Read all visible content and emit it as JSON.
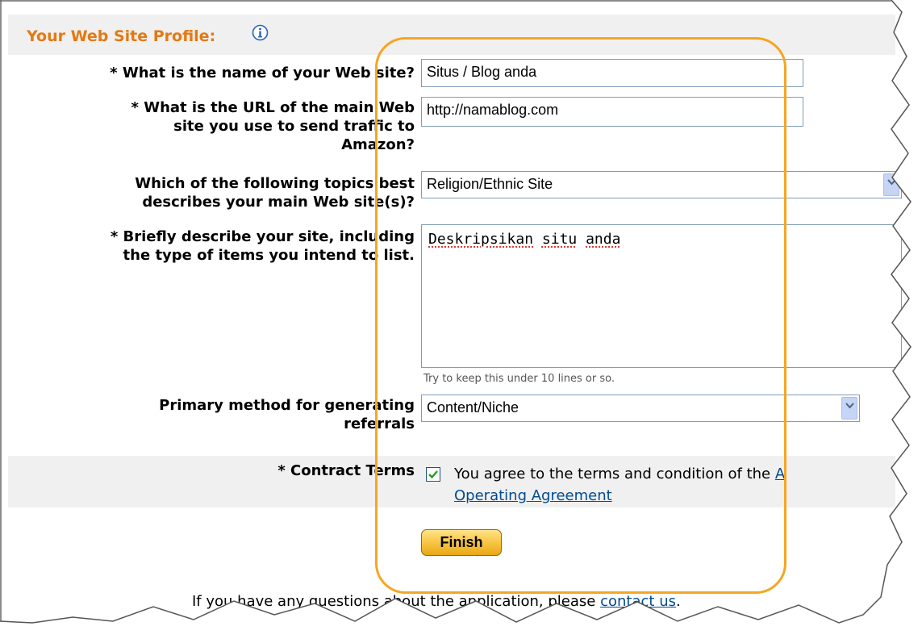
{
  "section": {
    "title": "Your Web Site Profile:"
  },
  "icons": {
    "info": "info-circle-icon",
    "dropdown": "chevron-down-icon",
    "check": "checkmark-icon"
  },
  "colors": {
    "title": "#e47911",
    "link": "#004b91",
    "highlight": "#f5a623",
    "band": "#f0f0f0",
    "button": "#f7c23d"
  },
  "fields": {
    "site_name": {
      "label": "* What is the name of your Web site?",
      "value": "Situs / Blog anda"
    },
    "site_url": {
      "label_lines": [
        "* What is the URL of the main Web",
        "site you use to send traffic to",
        "Amazon?"
      ],
      "value": "http://namablog.com"
    },
    "topic": {
      "label_lines": [
        "Which of the following topics best",
        "describes your main Web site(s)?"
      ],
      "value": "Religion/Ethnic Site"
    },
    "description": {
      "label_lines": [
        "* Briefly describe your site, including",
        "the type of items you intend to list."
      ],
      "words": [
        "Deskripsikan",
        "situ",
        "anda"
      ],
      "hint": "Try to keep this under 10 lines or so."
    },
    "referrals": {
      "label_lines": [
        "Primary method for generating",
        "referrals"
      ],
      "value": "Content/Niche"
    }
  },
  "contract": {
    "label": "* Contract Terms",
    "checked": true,
    "text": "You agree to the terms and condition of the",
    "link_fragment": "A",
    "link": "Operating Agreement"
  },
  "finish_label": "Finish",
  "footer": {
    "text": "If you have any questions about the application, please",
    "link": "contact us",
    "end": "."
  }
}
